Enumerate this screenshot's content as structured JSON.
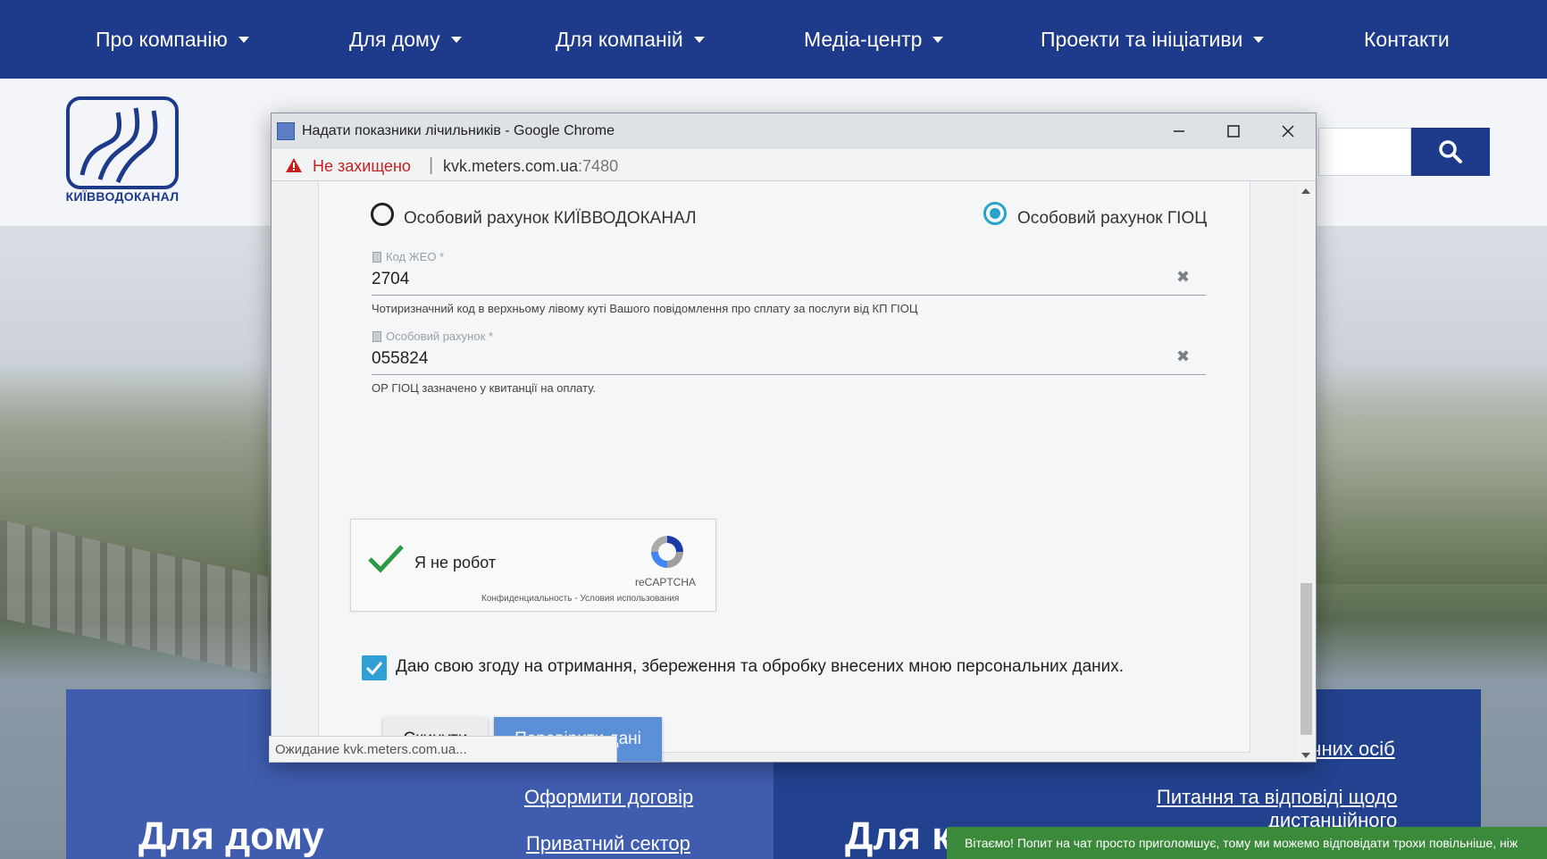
{
  "site": {
    "nav": [
      {
        "label": "Про компанію",
        "has_dropdown": true
      },
      {
        "label": "Для дому",
        "has_dropdown": true
      },
      {
        "label": "Для компаній",
        "has_dropdown": true
      },
      {
        "label": "Медіа-центр",
        "has_dropdown": true
      },
      {
        "label": "Проекти та ініціативи",
        "has_dropdown": true
      },
      {
        "label": "Контакти",
        "has_dropdown": false
      }
    ],
    "logo_text": "КИЇВВОДОКАНАЛ",
    "search_icon": "search-icon",
    "panels": {
      "home_title": "Для дому",
      "home_links": [
        "Оформити договір",
        "Приватний сектор"
      ],
      "biz_title": "Для к",
      "biz_links": [
        "чних осіб",
        "Питання та відповіді щодо",
        "дистанційного"
      ]
    },
    "chat_text": "Вітаємо! Попит на чат просто приголомшує, тому ми можемо відповідати трохи повільніше, ніж"
  },
  "popup": {
    "window_title": "Надати показники лічильників - Google Chrome",
    "security_label": "Не захищено",
    "url_host": "kvk.meters.com.ua",
    "url_port": ":7480",
    "status_text": "Ожидание kvk.meters.com.ua...",
    "form": {
      "radio_options": [
        {
          "label": "Особовий рахунок КИЇВВОДОКАНАЛ",
          "selected": false
        },
        {
          "label": "Особовий рахунок ГІОЦ",
          "selected": true
        }
      ],
      "zheo": {
        "label": "Код ЖЕО *",
        "value": "2704",
        "hint": "Чотиризначний код в верхньому лівому куті Вашого повідомлення про сплату за послуги від КП ГІОЦ"
      },
      "account": {
        "label": "Особовий рахунок *",
        "value": "055824",
        "hint": "ОР ГІОЦ зазначено у квитанції на оплату."
      },
      "captcha": {
        "label": "Я не робот",
        "brand": "reCAPTCHA",
        "terms": "Конфиденциальность - Условия использования",
        "checked": true
      },
      "consent": {
        "label": "Даю свою згоду на отримання, збереження та обробку внесених мною персональних даних.",
        "checked": true
      },
      "reset_label": "Скинути",
      "submit_label": "Перевірити дані"
    }
  },
  "colors": {
    "brand_blue": "#1e3a8a",
    "radio_accent": "#27a3c7",
    "submit_blue": "#5b8fd6",
    "insecure_red": "#c5221f",
    "chat_green": "#3b8a3b"
  }
}
